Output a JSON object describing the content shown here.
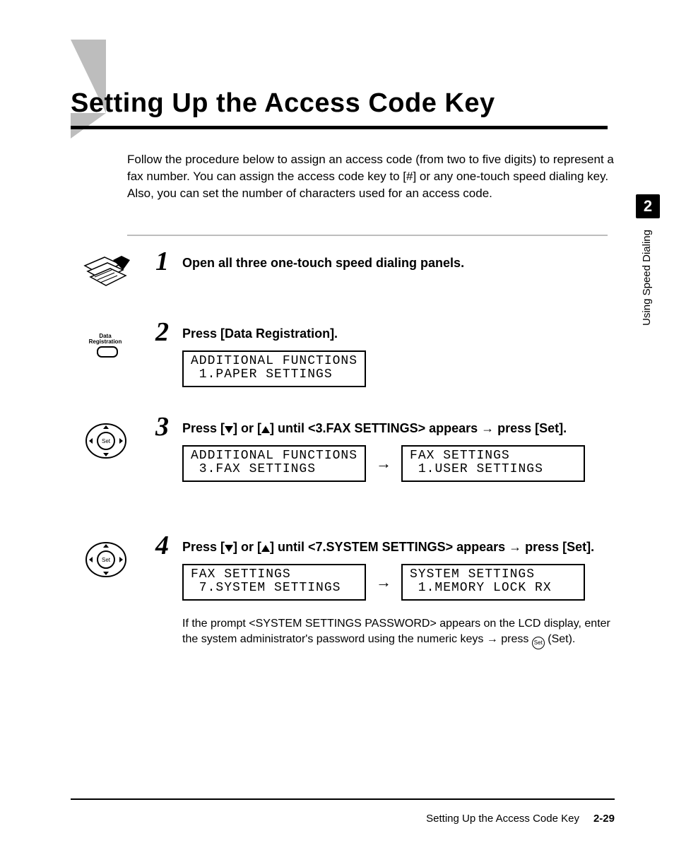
{
  "sidebar": {
    "chapter_number": "2",
    "chapter_label": "Using Speed Dialing"
  },
  "heading": "Setting Up the Access Code Key",
  "intro": "Follow the procedure below to assign an access code (from two to five digits) to represent a fax number. You can assign the access code key to [#] or any one-touch speed dialing key. Also, you can set the number of characters used for an access code.",
  "steps": [
    {
      "num": "1",
      "title": "Open all three one-touch speed dialing panels."
    },
    {
      "num": "2",
      "title": "Press [Data Registration].",
      "icon_label_line1": "Data",
      "icon_label_line2": "Registration",
      "lcd": [
        {
          "line1": "ADDITIONAL FUNCTIONS",
          "line2": " 1.PAPER SETTINGS"
        }
      ]
    },
    {
      "num": "3",
      "title_pre": "Press [",
      "title_mid1": "] or [",
      "title_mid2": "] until <3.FAX SETTINGS> appears ",
      "title_post": " press [Set].",
      "lcd": [
        {
          "line1": "ADDITIONAL FUNCTIONS",
          "line2": " 3.FAX SETTINGS"
        },
        {
          "line1": "FAX SETTINGS",
          "line2": " 1.USER SETTINGS"
        }
      ]
    },
    {
      "num": "4",
      "title_pre": "Press [",
      "title_mid1": "] or [",
      "title_mid2": "] until <7.SYSTEM SETTINGS> appears ",
      "title_post": " press [Set].",
      "lcd": [
        {
          "line1": "FAX SETTINGS",
          "line2": " 7.SYSTEM SETTINGS"
        },
        {
          "line1": "SYSTEM SETTINGS",
          "line2": " 1.MEMORY LOCK RX"
        }
      ],
      "note_pre": "If the prompt <SYSTEM SETTINGS PASSWORD> appears on the LCD display, enter the system administrator's password using the numeric keys ",
      "note_post": " press ",
      "note_tail": " (Set).",
      "set_badge_text": "Set"
    }
  ],
  "footer": {
    "title": "Setting Up the Access Code Key",
    "page": "2-29"
  },
  "arrow_glyph": "→"
}
